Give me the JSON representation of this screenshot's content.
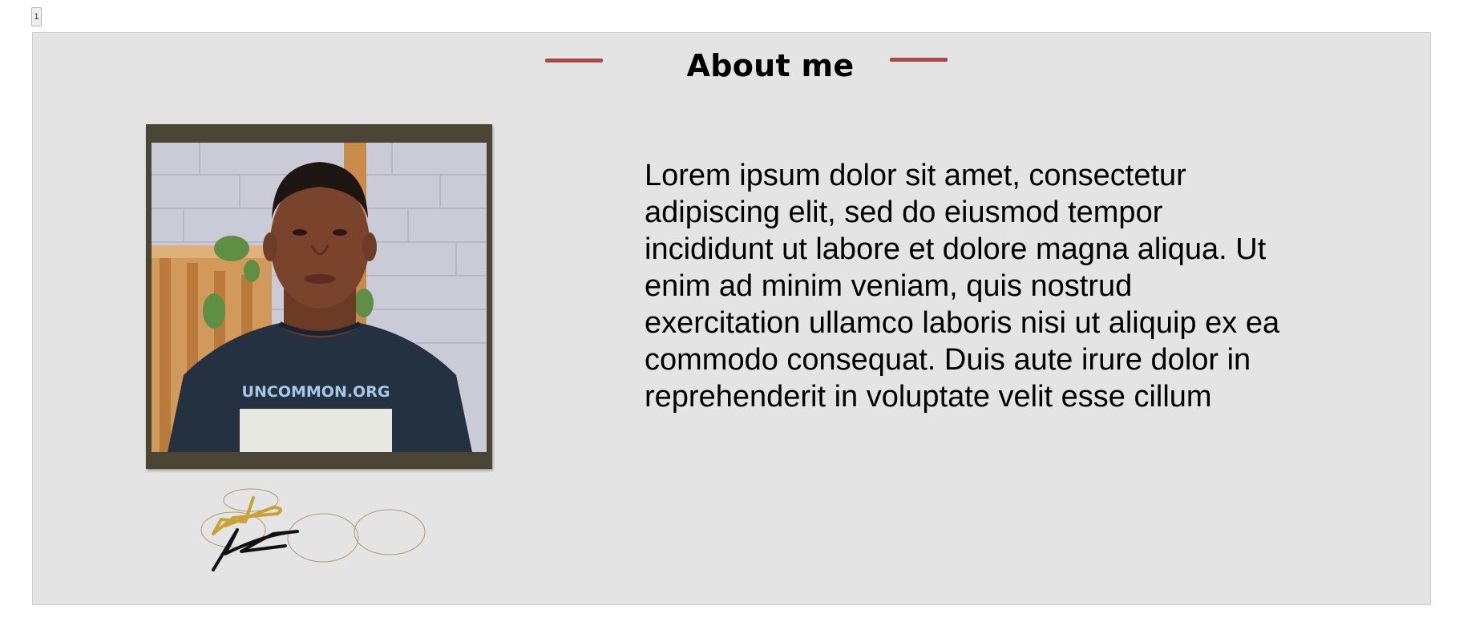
{
  "page": {
    "number": "1"
  },
  "slide": {
    "title": "About me",
    "title_accent_color": "#a84a46",
    "background_color": "#e4e4e4",
    "body_text": "Lorem ipsum dolor sit amet, consectetur\nadipiscing elit, sed do eiusmod tempor\nincididunt ut labore et dolore magna aliqua. Ut\nenim ad minim veniam, quis nostrud\nexercitation ullamco laboris nisi ut aliquip ex ea\ncommodo consequat. Duis aute irure dolor in\nreprehenderit in voluptate velit esse cillum",
    "photo": {
      "shirt_text": "UNCOMMON.ORG",
      "frame_color": "#4a4535"
    },
    "signature": {
      "gold_color": "#c9a235",
      "ink_color": "#111111"
    }
  }
}
